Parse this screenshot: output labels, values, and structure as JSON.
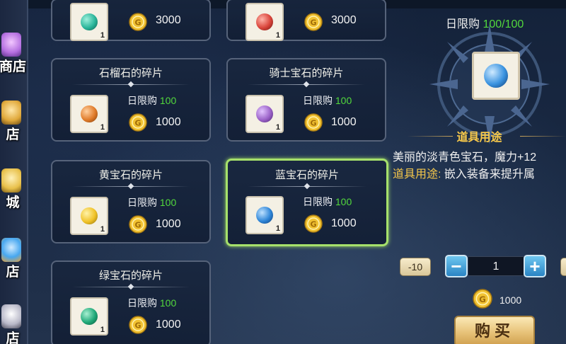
{
  "sidebar": {
    "items": [
      {
        "label": "商店",
        "icon": "flower-gem-icon",
        "color": "#c986e8"
      },
      {
        "label": "店",
        "icon": "crown-gem-icon",
        "color": "#e0a83a"
      },
      {
        "label": "城",
        "icon": "gold-crown-icon",
        "color": "#e8c04a"
      },
      {
        "label": "店",
        "icon": "blue-flame-gem-icon",
        "color": "#47a7f0"
      },
      {
        "label": "店",
        "icon": "wing-gem-icon",
        "color": "#b8b8c8"
      }
    ]
  },
  "items": [
    {
      "name": "",
      "limit_label": "",
      "limit_value": "",
      "price": "3000",
      "orb_color": "#2ab59a",
      "qty": "1"
    },
    {
      "name": "",
      "limit_label": "",
      "limit_value": "",
      "price": "3000",
      "orb_color": "#d9443a",
      "qty": "1"
    },
    {
      "name": "石榴石的碎片",
      "limit_label": "日限购",
      "limit_value": "100",
      "price": "1000",
      "orb_color": "#e07b2a",
      "qty": "1"
    },
    {
      "name": "骑士宝石的碎片",
      "limit_label": "日限购",
      "limit_value": "100",
      "price": "1000",
      "orb_color": "#9b62c8",
      "qty": "1"
    },
    {
      "name": "黄宝石的碎片",
      "limit_label": "日限购",
      "limit_value": "100",
      "price": "1000",
      "orb_color": "#f0c228",
      "qty": "1"
    },
    {
      "name": "蓝宝石的碎片",
      "limit_label": "日限购",
      "limit_value": "100",
      "price": "1000",
      "orb_color": "#2f86d8",
      "qty": "1"
    },
    {
      "name": "绿宝石的碎片",
      "limit_label": "日限购",
      "limit_value": "100",
      "price": "1000",
      "orb_color": "#1fa878",
      "qty": "1"
    }
  ],
  "detail": {
    "limit_label": "日限购",
    "limit_value": "100/100",
    "orb_color": "#3a93e0",
    "usage_title": "道具用途",
    "desc_line1": "美丽的淡青色宝石，魔力+12",
    "desc_line2_label": "道具用途:",
    "desc_line2_text": "嵌入装备来提升属",
    "minus10_label": "-10",
    "minus_label": "−",
    "quantity": "1",
    "plus_label": "+",
    "total_price": "1000",
    "buy_label": "购买"
  },
  "colors": {
    "limit_green": "#52d83c",
    "selected_border": "#a6e16b",
    "usage_gold": "#f6c84a"
  }
}
